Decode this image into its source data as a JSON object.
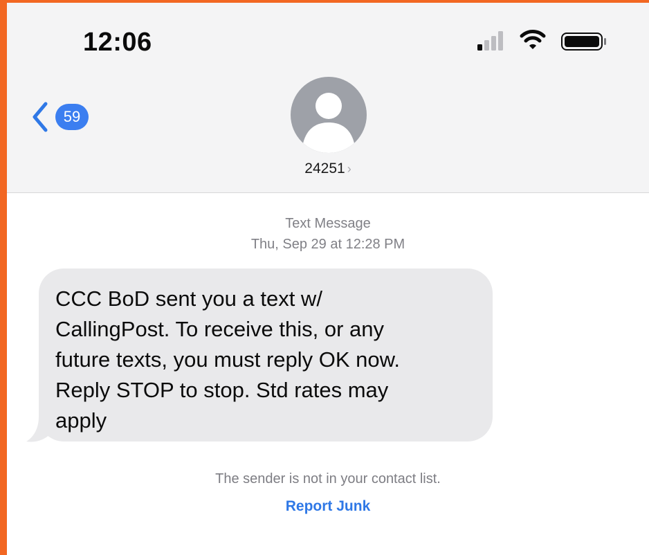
{
  "status_bar": {
    "time": "12:06",
    "icons": [
      "cellular-signal-icon",
      "wifi-icon",
      "battery-icon"
    ]
  },
  "header": {
    "back_badge_count": "59",
    "contact_name": "24251",
    "contact_chevron": "›",
    "avatar_icon": "person-silhouette-icon"
  },
  "conversation": {
    "message_kind": "Text Message",
    "timestamp": "Thu, Sep 29 at 12:28 PM",
    "incoming_message": "CCC BoD sent you a text w/\nCallingPost. To receive this, or any\nfuture texts, you must reply OK now.\nReply STOP to stop. Std rates may\napply"
  },
  "footer": {
    "sender_note": "The sender is not in your contact list.",
    "report_junk_label": "Report Junk"
  },
  "colors": {
    "page_border": "#F26722",
    "header_bg": "#F4F4F5",
    "bubble_bg": "#E9E9EB",
    "accent_blue": "#2F78E6",
    "badge_blue": "#3B7EF0",
    "avatar_gray": "#9EA1A8"
  }
}
